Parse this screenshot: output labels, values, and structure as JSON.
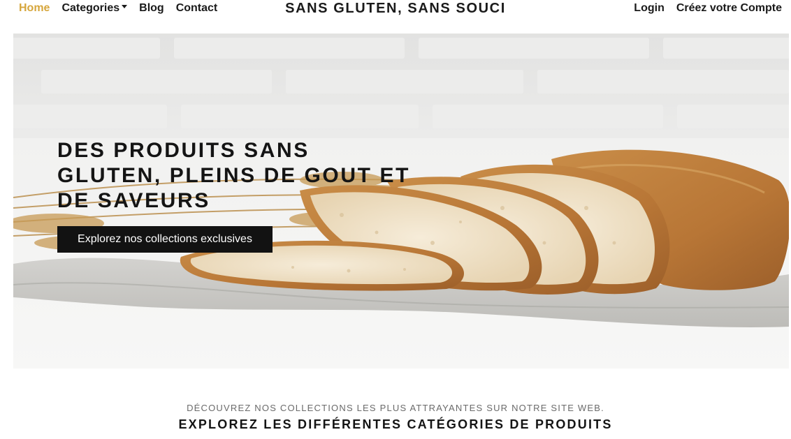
{
  "nav": {
    "home_label": "Home",
    "categories_label": "Categories",
    "blog_label": "Blog",
    "contact_label": "Contact",
    "brand": "SANS GLUTEN, SANS SOUCI",
    "login_label": "Login",
    "register_label": "Créez votre Compte"
  },
  "hero": {
    "title": "DES PRODUITS SANS GLUTEN, PLEINS DE GOUT ET DE SAVEURS",
    "cta_label": "Explorez nos collections exclusives"
  },
  "section": {
    "subtitle": "Découvrez nos collections les plus attrayantes sur notre site web.",
    "title": "EXPLOREZ LES DIFFÉRENTES CATÉGORIES DE PRODUITS"
  },
  "colors": {
    "accent": "#d6a63c",
    "button_bg": "#121212",
    "text": "#141414"
  }
}
